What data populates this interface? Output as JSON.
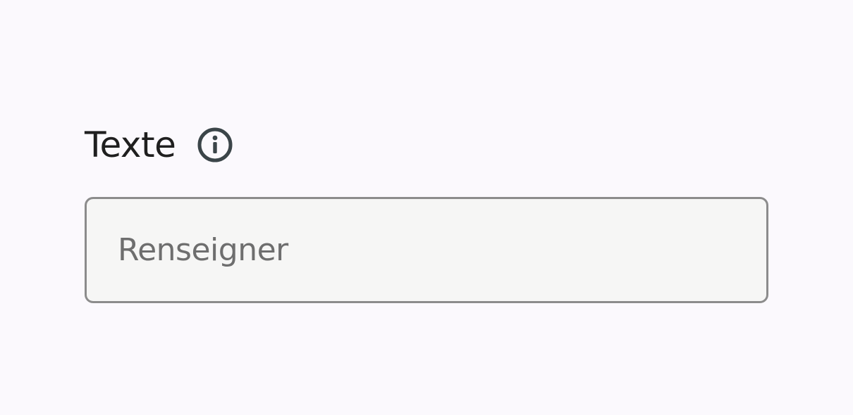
{
  "field": {
    "label": "Texte",
    "info_icon": "info-circle-icon",
    "input_value": "",
    "placeholder": "Renseigner"
  },
  "colors": {
    "background": "#fbf9fd",
    "label": "#1f1f1f",
    "icon": "#3b4549",
    "input_border": "#8c8c8c",
    "input_background": "#f6f6f5",
    "placeholder": "#6e6e6e"
  }
}
